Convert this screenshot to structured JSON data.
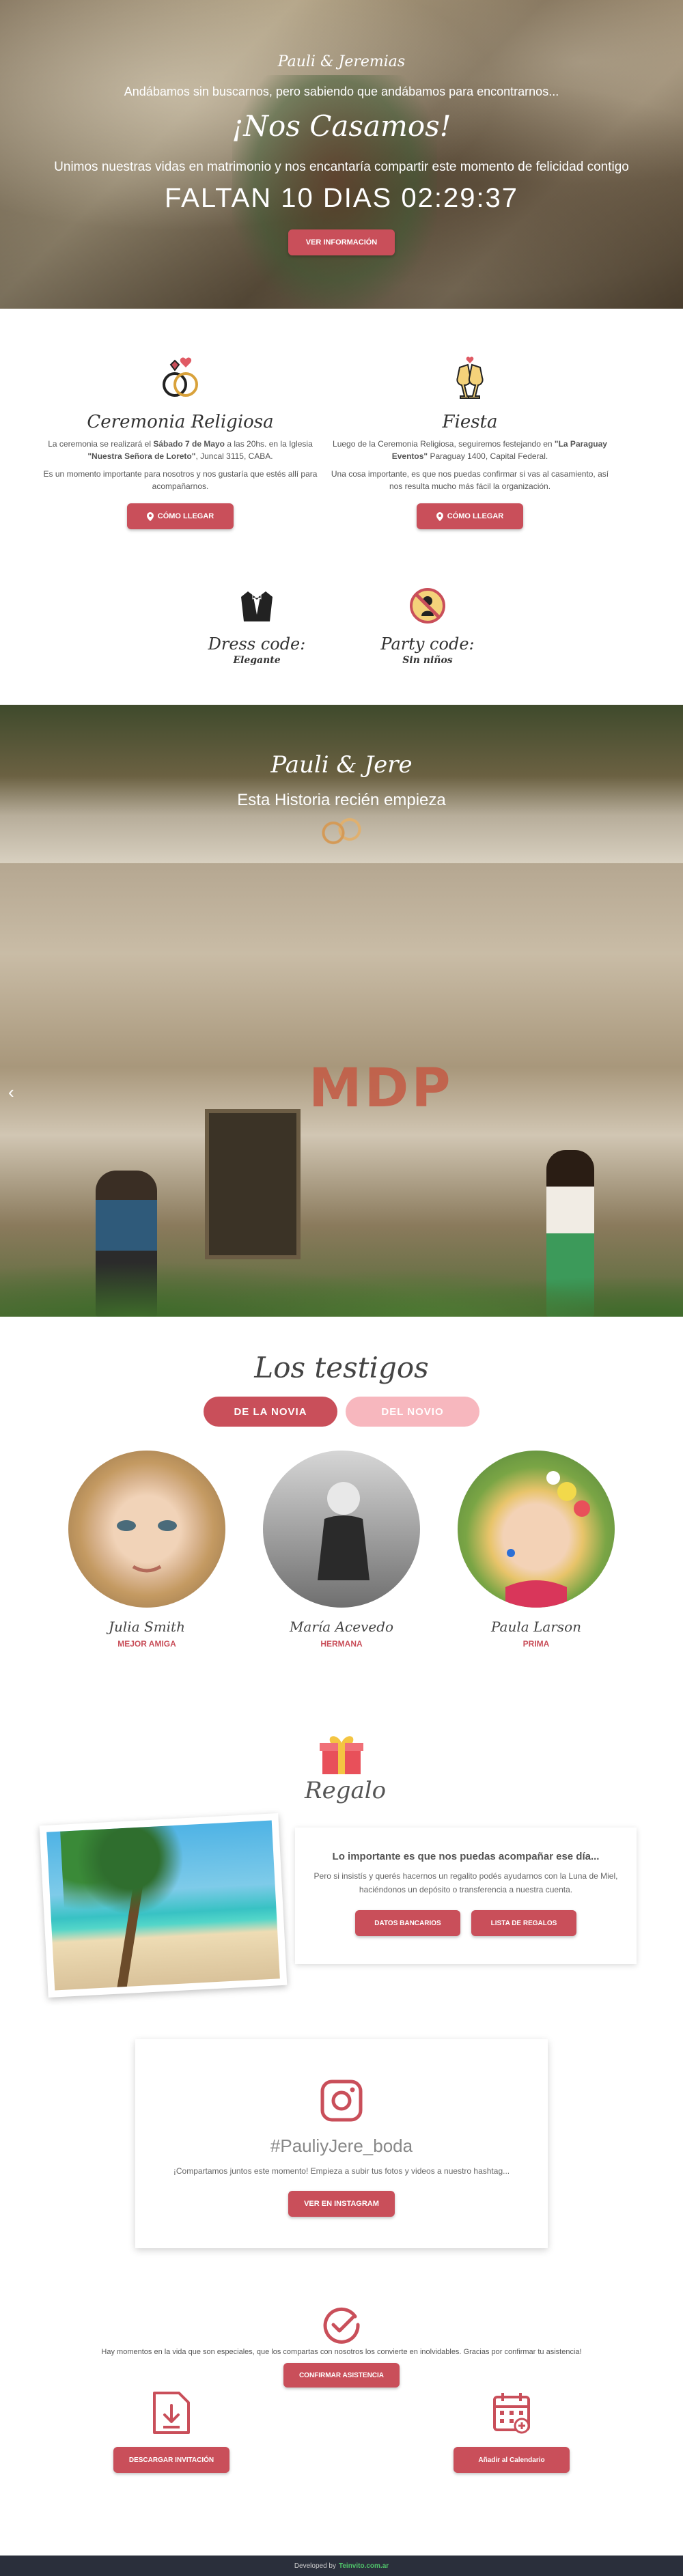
{
  "hero": {
    "names": "Pauli & Jeremias",
    "tagline": "Andábamos sin buscarnos, pero sabiendo que andábamos para encontrarnos...",
    "headline": "¡Nos Casamos!",
    "subline": "Unimos nuestras vidas en matrimonio y nos encantaría compartir este momento de felicidad contigo",
    "countdown": "FALTAN 10 DIAS 02:29:37",
    "button": "VER INFORMACIÓN"
  },
  "ceremony": {
    "title": "Ceremonia Religiosa",
    "text_pre": "La ceremonia se realizará el ",
    "text_date": "Sábado 7 de Mayo",
    "text_mid": " a las 20hs. en la Iglesia ",
    "text_place": "\"Nuestra Señora de Loreto\"",
    "text_post": ", Juncal 3115, CABA.",
    "text2": "Es un momento importante para nosotros y nos gustaría que estés allí para acompañarnos.",
    "button": "CÓMO LLEGAR"
  },
  "party": {
    "title": "Fiesta",
    "text_pre": "Luego de la Ceremonia Religiosa, seguiremos festejando en ",
    "text_place": "\"La Paraguay Eventos\"",
    "text_post": " Paraguay 1400, Capital Federal.",
    "text2": "Una cosa importante, es que nos puedas confirmar si vas al casamiento, así nos resulta mucho más fácil la organización.",
    "button": "CÓMO LLEGAR"
  },
  "dress": {
    "title": "Dress code:",
    "value": "Elegante"
  },
  "partycode": {
    "title": "Party code:",
    "value": "Sin niños"
  },
  "story": {
    "title": "Pauli & Jere",
    "subtitle": "Esta Historia recién empieza",
    "prev_arrow": "‹",
    "wall_text": "MDP"
  },
  "witnesses": {
    "title": "Los testigos",
    "tabs": [
      "DE LA NOVIA",
      "DEL NOVIO"
    ],
    "people": [
      {
        "name": "Julia Smith",
        "role": "MEJOR AMIGA"
      },
      {
        "name": "María Acevedo",
        "role": "HERMANA"
      },
      {
        "name": "Paula Larson",
        "role": "PRIMA"
      }
    ]
  },
  "gift": {
    "title": "Regalo",
    "heading": "Lo importante es que nos puedas acompañar ese día...",
    "text": "Pero si insistís y querés hacernos un regalito podés ayudarnos con la Luna de Miel, haciéndonos un depósito o transferencia a nuestra cuenta.",
    "buttons": [
      "DATOS BANCARIOS",
      "LISTA DE REGALOS"
    ]
  },
  "instagram": {
    "hashtag": "#PauliyJere_boda",
    "text": "¡Compartamos juntos este momento! Empieza a subir tus fotos y videos a nuestro hashtag...",
    "button": "VER EN INSTAGRAM"
  },
  "confirm": {
    "text": "Hay momentos en la vida que son especiales, que los compartas con nosotros los convierte en inolvidables. Gracias por confirmar tu asistencia!",
    "button": "CONFIRMAR ASISTENCIA"
  },
  "downloads": {
    "invite_button": "DESCARGAR INVITACIÓN",
    "calendar_button": "Añadir al Calendario"
  },
  "footer": {
    "prefix": "Developed by",
    "link": "Teinvito.com.ar"
  },
  "colors": {
    "accent": "#c94f5a",
    "accent_light": "#f7b7be",
    "footer_bg": "#2a2f3b"
  }
}
